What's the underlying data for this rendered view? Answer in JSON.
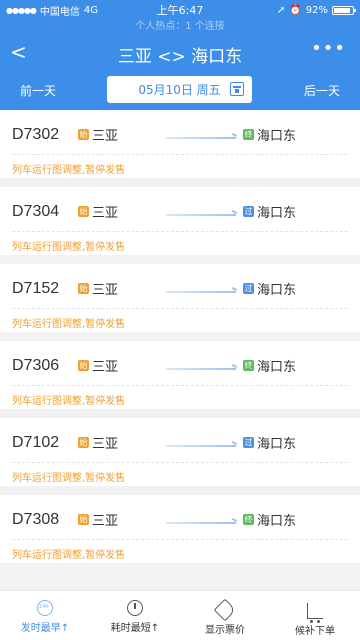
{
  "status_bar": {
    "carrier": "中国电信",
    "network": "4G",
    "time": "上午6:47",
    "battery": "92%"
  },
  "hotspot_text": "个人热点：1 个连接",
  "header": {
    "title": "三亚 <> 海口东"
  },
  "date_nav": {
    "prev_label": "前一天",
    "date_label": "05月10日 周五",
    "next_label": "后一天"
  },
  "trains": [
    {
      "number": "D7302",
      "from": "三亚",
      "from_tag": "始",
      "to": "海口东",
      "to_tag": "终",
      "to_tag_color": "#5cb85c",
      "notice": "列车运行图调整,暂停发售"
    },
    {
      "number": "D7304",
      "from": "三亚",
      "from_tag": "始",
      "to": "海口东",
      "to_tag": "过",
      "to_tag_color": "#4a90e2",
      "notice": "列车运行图调整,暂停发售"
    },
    {
      "number": "D7152",
      "from": "三亚",
      "from_tag": "始",
      "to": "海口东",
      "to_tag": "过",
      "to_tag_color": "#4a90e2",
      "notice": "列车运行图调整,暂停发售"
    },
    {
      "number": "D7306",
      "from": "三亚",
      "from_tag": "始",
      "to": "海口东",
      "to_tag": "终",
      "to_tag_color": "#5cb85c",
      "notice": "列车运行图调整,暂停发售"
    },
    {
      "number": "D7102",
      "from": "三亚",
      "from_tag": "始",
      "to": "海口东",
      "to_tag": "过",
      "to_tag_color": "#4a90e2",
      "notice": "列车运行图调整,暂停发售"
    },
    {
      "number": "D7308",
      "from": "三亚",
      "from_tag": "始",
      "to": "海口东",
      "to_tag": "终",
      "to_tag_color": "#5cb85c",
      "notice": "列车运行图调整,暂停发售"
    }
  ],
  "from_tag_color": "#f0a030",
  "tabbar": {
    "tabs": [
      {
        "label": "发时最早↑",
        "icon": "clock-24h-icon",
        "active": true
      },
      {
        "label": "耗时最短↑",
        "icon": "timer-icon",
        "active": false
      },
      {
        "label": "显示票价",
        "icon": "price-tag-icon",
        "active": false
      },
      {
        "label": "候补下单",
        "icon": "cart-icon",
        "active": false
      }
    ]
  },
  "colors": {
    "primary": "#3d8ee8",
    "notice": "#f0a030"
  }
}
